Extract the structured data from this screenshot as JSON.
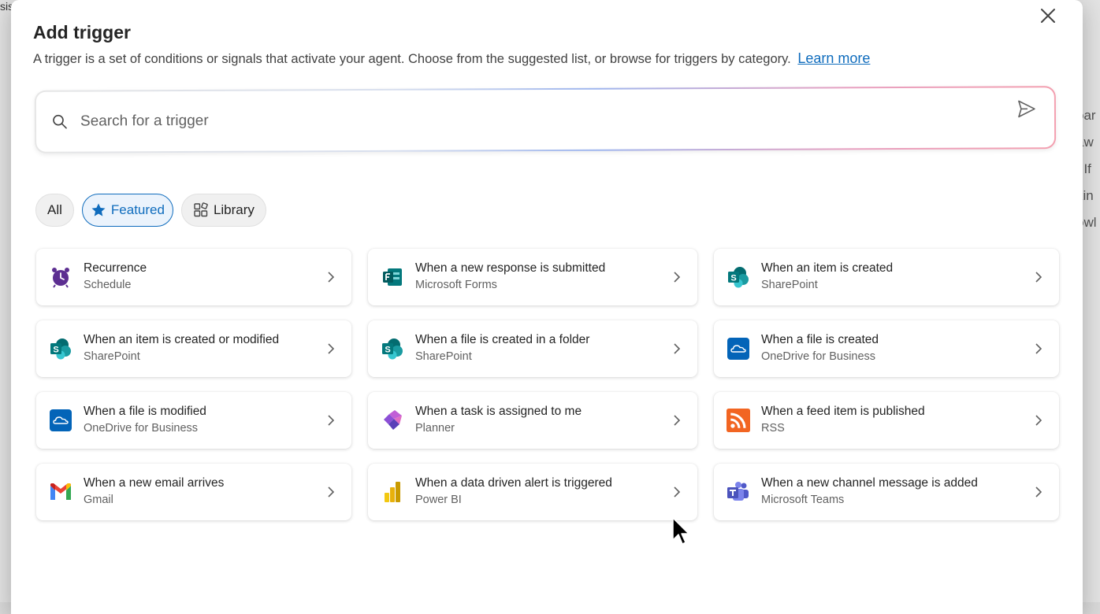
{
  "dialog": {
    "title": "Add trigger",
    "subtitle": "A trigger is a set of conditions or signals that activate your agent. Choose from the suggested list, or browse for triggers by category.",
    "learn_more": "Learn more",
    "close_icon": "close-icon"
  },
  "search": {
    "placeholder": "Search for a trigger",
    "value": "",
    "icon": "search-icon",
    "send_icon": "send-icon"
  },
  "filters": [
    {
      "label": "All",
      "active": false
    },
    {
      "label": "Featured",
      "active": true,
      "icon": "star-icon"
    },
    {
      "label": "Library",
      "active": false,
      "icon": "library-icon"
    }
  ],
  "triggers": [
    {
      "title": "Recurrence",
      "app": "Schedule",
      "icon": "alarm-clock-icon"
    },
    {
      "title": "When a new response is submitted",
      "app": "Microsoft Forms",
      "icon": "microsoft-forms-icon"
    },
    {
      "title": "When an item is created",
      "app": "SharePoint",
      "icon": "sharepoint-icon"
    },
    {
      "title": "When an item is created or modified",
      "app": "SharePoint",
      "icon": "sharepoint-icon"
    },
    {
      "title": "When a file is created in a folder",
      "app": "SharePoint",
      "icon": "sharepoint-icon"
    },
    {
      "title": "When a file is created",
      "app": "OneDrive for Business",
      "icon": "onedrive-icon"
    },
    {
      "title": "When a file is modified",
      "app": "OneDrive for Business",
      "icon": "onedrive-icon"
    },
    {
      "title": "When a task is assigned to me",
      "app": "Planner",
      "icon": "planner-icon"
    },
    {
      "title": "When a feed item is published",
      "app": "RSS",
      "icon": "rss-icon"
    },
    {
      "title": "When a new email arrives",
      "app": "Gmail",
      "icon": "gmail-icon"
    },
    {
      "title": "When a data driven alert is triggered",
      "app": "Power BI",
      "icon": "power-bi-icon"
    },
    {
      "title": "When a new channel message is added",
      "app": "Microsoft Teams",
      "icon": "teams-icon"
    }
  ],
  "colors": {
    "accent": "#0f6cbd",
    "featured_bg": "#ebf3fc"
  }
}
